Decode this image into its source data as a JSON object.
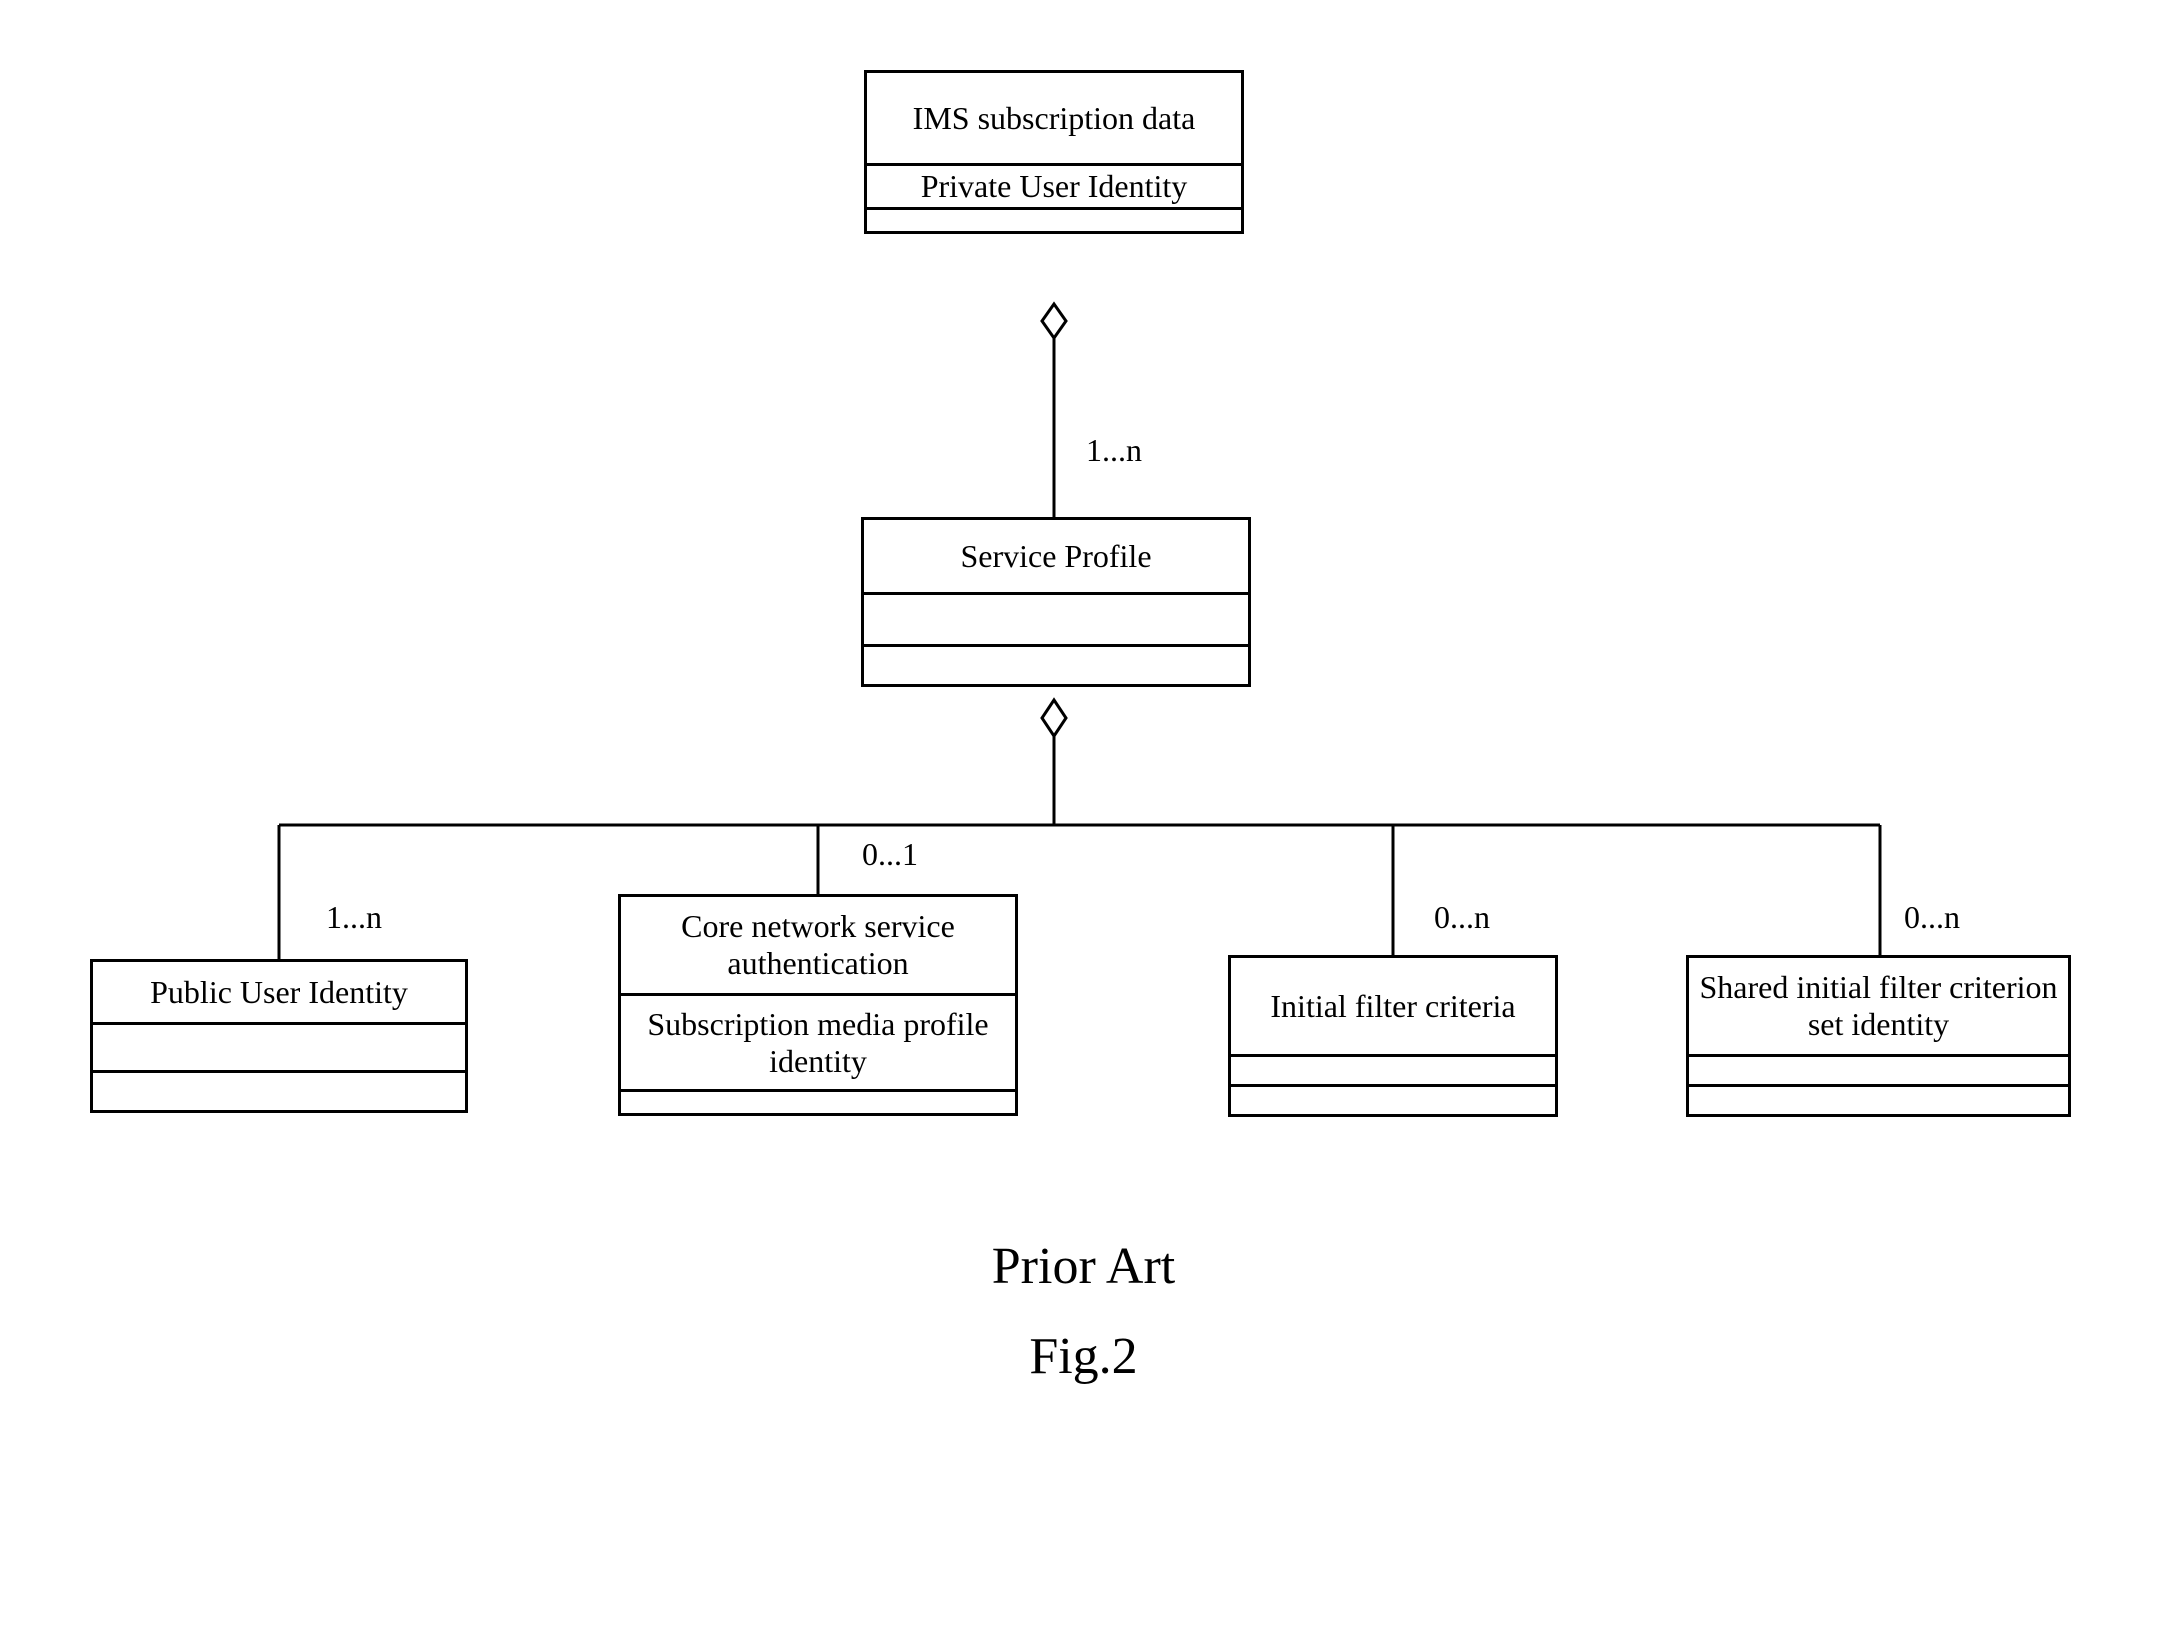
{
  "boxes": {
    "ims": {
      "title": "IMS subscription data",
      "attr": "Private User Identity"
    },
    "sp": {
      "title": "Service Profile"
    },
    "pui": {
      "title": "Public User Identity"
    },
    "cns": {
      "title": "Core network service authentication",
      "attr": "Subscription media profile identity"
    },
    "ifc": {
      "title": "Initial filter criteria"
    },
    "sifc": {
      "title": "Shared initial filter criterion set identity"
    }
  },
  "multiplicities": {
    "sp": "1...n",
    "pui": "1...n",
    "cns": "0...1",
    "ifc": "0...n",
    "sifc": "0...n"
  },
  "caption": {
    "line1": "Prior Art",
    "line2": "Fig.2"
  },
  "chart_data": {
    "type": "uml_class",
    "classes": [
      {
        "id": "ims",
        "name": "IMS subscription data",
        "attributes": [
          "Private User Identity"
        ]
      },
      {
        "id": "sp",
        "name": "Service Profile"
      },
      {
        "id": "pui",
        "name": "Public User Identity"
      },
      {
        "id": "cns",
        "name": "Core network service authentication",
        "attributes": [
          "Subscription media profile identity"
        ]
      },
      {
        "id": "ifc",
        "name": "Initial filter criteria"
      },
      {
        "id": "sifc",
        "name": "Shared initial filter criterion set identity"
      }
    ],
    "relationships": [
      {
        "from": "ims",
        "to": "sp",
        "type": "aggregation",
        "multiplicity": "1...n"
      },
      {
        "from": "sp",
        "to": "pui",
        "type": "aggregation",
        "multiplicity": "1...n"
      },
      {
        "from": "sp",
        "to": "cns",
        "type": "aggregation",
        "multiplicity": "0...1"
      },
      {
        "from": "sp",
        "to": "ifc",
        "type": "aggregation",
        "multiplicity": "0...n"
      },
      {
        "from": "sp",
        "to": "sifc",
        "type": "aggregation",
        "multiplicity": "0...n"
      }
    ]
  }
}
